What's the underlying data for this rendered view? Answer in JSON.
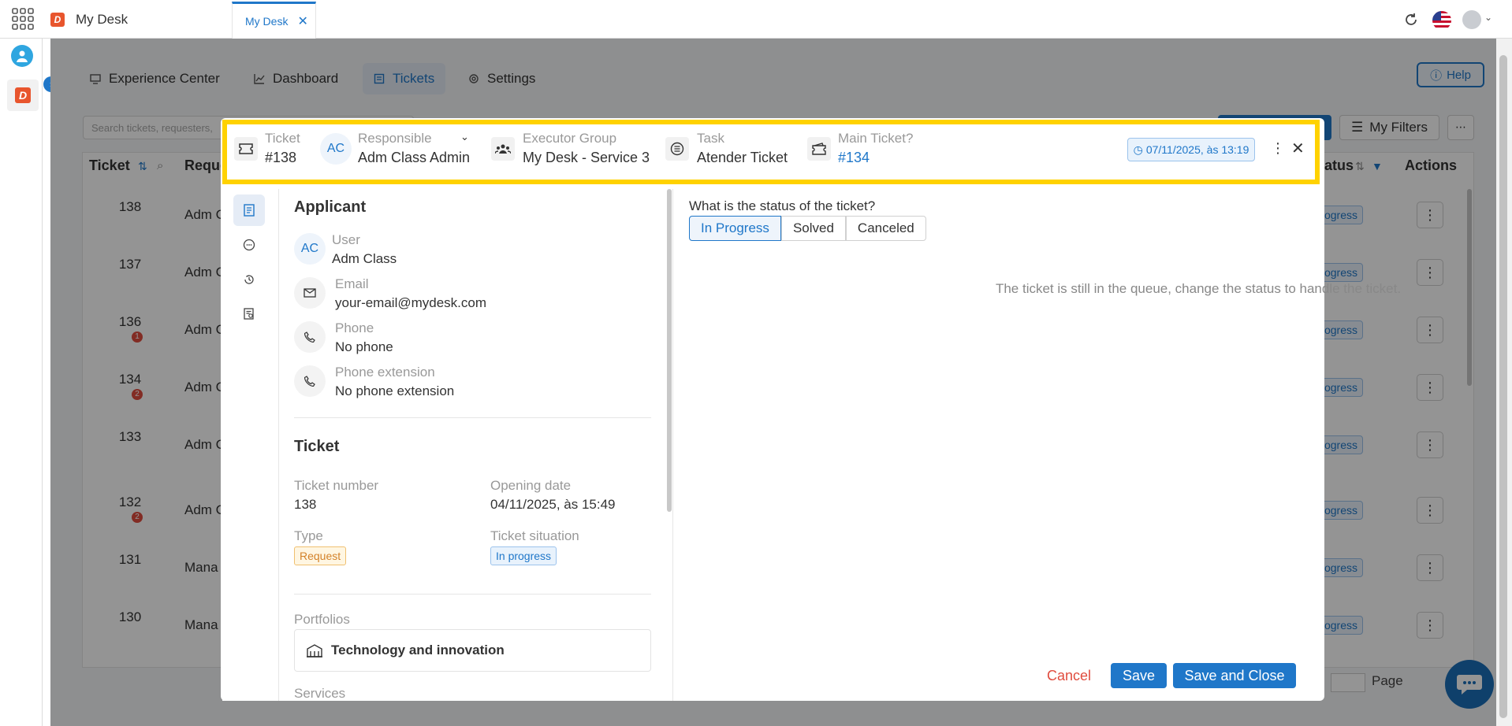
{
  "app": {
    "title": "My Desk"
  },
  "tabs": [
    {
      "label": "My Desk",
      "close": "✕"
    }
  ],
  "nav": {
    "items": [
      {
        "label": "Experience Center"
      },
      {
        "label": "Dashboard"
      },
      {
        "label": "Tickets"
      },
      {
        "label": "Settings"
      }
    ],
    "help": "Help"
  },
  "toolbar": {
    "search_placeholder": "Search tickets, requesters,",
    "my_filters": "My Filters",
    "more": "⋯"
  },
  "table": {
    "headers": {
      "ticket": "Ticket",
      "requester": "Reque",
      "status": "tatus",
      "actions": "Actions"
    },
    "rows": [
      {
        "id": "138",
        "requester": "Adm C",
        "status": "rogress",
        "badge": ""
      },
      {
        "id": "137",
        "requester": "Adm C",
        "status": "rogress",
        "badge": ""
      },
      {
        "id": "136",
        "requester": "Adm C",
        "status": "rogress",
        "badge": "1"
      },
      {
        "id": "134",
        "requester": "Adm C",
        "status": "rogress",
        "badge": "2"
      },
      {
        "id": "133",
        "requester": "Adm C",
        "status": "rogress",
        "badge": ""
      },
      {
        "id": "132",
        "requester": "Adm C",
        "status": "rogress",
        "badge": "2"
      },
      {
        "id": "131",
        "requester": "Mana",
        "status": "rogress",
        "badge": ""
      },
      {
        "id": "130",
        "requester": "Mana",
        "status": "rogress",
        "badge": ""
      }
    ],
    "action_glyph": "⋮",
    "page_label": "Page"
  },
  "modal": {
    "header": {
      "ticket_label": "Ticket",
      "ticket_value": "#138",
      "responsible_initials": "AC",
      "responsible_label": "Responsible",
      "responsible_value": "Adm Class Admin",
      "executor_label": "Executor Group",
      "executor_value": "My Desk - Service 3",
      "task_label": "Task",
      "task_value": "Atender Ticket",
      "main_label": "Main Ticket?",
      "main_value": "#134",
      "date": "07/11/2025, às 13:19"
    },
    "applicant": {
      "title": "Applicant",
      "user_initials": "AC",
      "user_label": "User",
      "user_value": "Adm Class",
      "email_label": "Email",
      "email_value": "your-email@mydesk.com",
      "phone_label": "Phone",
      "phone_value": "No phone",
      "ext_label": "Phone extension",
      "ext_value": "No phone extension"
    },
    "ticket": {
      "title": "Ticket",
      "number_label": "Ticket number",
      "number_value": "138",
      "opening_label": "Opening date",
      "opening_value": "04/11/2025, às 15:49",
      "type_label": "Type",
      "type_value": "Request",
      "situation_label": "Ticket situation",
      "situation_value": "In progress"
    },
    "portfolios_label": "Portfolios",
    "portfolio_value": "Technology and innovation",
    "services_label": "Services",
    "status": {
      "question": "What is the status of the ticket?",
      "options": [
        "In Progress",
        "Solved",
        "Canceled"
      ],
      "selected": "In Progress",
      "queue_message": "The ticket is still in the queue, change the status to handle the ticket."
    },
    "buttons": {
      "cancel": "Cancel",
      "save": "Save",
      "save_close": "Save and Close"
    }
  },
  "colors": {
    "accent": "#1f77c9",
    "highlight": "#ffd200",
    "danger": "#e04c3e",
    "brand": "#e8552d"
  }
}
